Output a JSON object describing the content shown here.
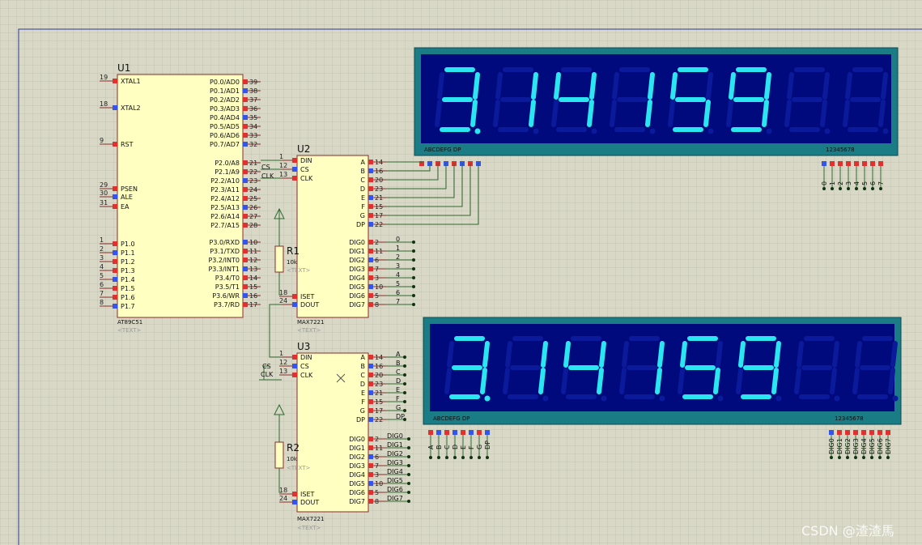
{
  "u1": {
    "ref": "U1",
    "part": "AT89C51",
    "text_placeholder": "<TEXT>",
    "left_pins": [
      {
        "num": "19",
        "label": "XTAL1"
      },
      {
        "num": "18",
        "label": "XTAL2"
      },
      {
        "num": "9",
        "label": "RST"
      },
      {
        "num": "29",
        "label": "PSEN"
      },
      {
        "num": "30",
        "label": "ALE"
      },
      {
        "num": "31",
        "label": "EA"
      },
      {
        "num": "1",
        "label": "P1.0"
      },
      {
        "num": "2",
        "label": "P1.1"
      },
      {
        "num": "3",
        "label": "P1.2"
      },
      {
        "num": "4",
        "label": "P1.3"
      },
      {
        "num": "5",
        "label": "P1.4"
      },
      {
        "num": "6",
        "label": "P1.5"
      },
      {
        "num": "7",
        "label": "P1.6"
      },
      {
        "num": "8",
        "label": "P1.7"
      }
    ],
    "right_pins": [
      {
        "num": "39",
        "label": "P0.0/AD0"
      },
      {
        "num": "38",
        "label": "P0.1/AD1"
      },
      {
        "num": "37",
        "label": "P0.2/AD2"
      },
      {
        "num": "36",
        "label": "P0.3/AD3"
      },
      {
        "num": "35",
        "label": "P0.4/AD4"
      },
      {
        "num": "34",
        "label": "P0.5/AD5"
      },
      {
        "num": "33",
        "label": "P0.6/AD6"
      },
      {
        "num": "32",
        "label": "P0.7/AD7"
      },
      {
        "num": "21",
        "label": "P2.0/A8"
      },
      {
        "num": "22",
        "label": "P2.1/A9"
      },
      {
        "num": "23",
        "label": "P2.2/A10"
      },
      {
        "num": "24",
        "label": "P2.3/A11"
      },
      {
        "num": "25",
        "label": "P2.4/A12"
      },
      {
        "num": "26",
        "label": "P2.5/A13"
      },
      {
        "num": "27",
        "label": "P2.6/A14"
      },
      {
        "num": "28",
        "label": "P2.7/A15"
      },
      {
        "num": "10",
        "label": "P3.0/RXD"
      },
      {
        "num": "11",
        "label": "P3.1/TXD"
      },
      {
        "num": "12",
        "label": "P3.2/INT0"
      },
      {
        "num": "13",
        "label": "P3.3/INT1"
      },
      {
        "num": "14",
        "label": "P3.4/T0"
      },
      {
        "num": "15",
        "label": "P3.5/T1"
      },
      {
        "num": "16",
        "label": "P3.6/WR"
      },
      {
        "num": "17",
        "label": "P3.7/RD"
      }
    ]
  },
  "u2": {
    "ref": "U2",
    "part": "MAX7221",
    "text_placeholder": "<TEXT>",
    "left_pins": [
      {
        "num": "1",
        "label": "DIN"
      },
      {
        "num": "12",
        "label": "CS"
      },
      {
        "num": "13",
        "label": "CLK"
      },
      {
        "num": "18",
        "label": "ISET"
      },
      {
        "num": "24",
        "label": "DOUT"
      }
    ],
    "right_pins": [
      {
        "num": "14",
        "label": "A"
      },
      {
        "num": "16",
        "label": "B"
      },
      {
        "num": "20",
        "label": "C"
      },
      {
        "num": "23",
        "label": "D"
      },
      {
        "num": "21",
        "label": "E"
      },
      {
        "num": "15",
        "label": "F"
      },
      {
        "num": "17",
        "label": "G"
      },
      {
        "num": "22",
        "label": "DP"
      },
      {
        "num": "2",
        "label": "DIG0"
      },
      {
        "num": "11",
        "label": "DIG1"
      },
      {
        "num": "6",
        "label": "DIG2"
      },
      {
        "num": "7",
        "label": "DIG3"
      },
      {
        "num": "3",
        "label": "DIG4"
      },
      {
        "num": "10",
        "label": "DIG5"
      },
      {
        "num": "5",
        "label": "DIG6"
      },
      {
        "num": "8",
        "label": "DIG7"
      }
    ],
    "digit_net_labels": [
      "0",
      "1",
      "2",
      "3",
      "4",
      "5",
      "6",
      "7"
    ]
  },
  "u3": {
    "ref": "U3",
    "part": "MAX7221",
    "text_placeholder": "<TEXT>",
    "left_pins": [
      {
        "num": "1",
        "label": "DIN"
      },
      {
        "num": "12",
        "label": "CS"
      },
      {
        "num": "13",
        "label": "CLK"
      },
      {
        "num": "18",
        "label": "ISET"
      },
      {
        "num": "24",
        "label": "DOUT"
      }
    ],
    "right_pins": [
      {
        "num": "14",
        "label": "A"
      },
      {
        "num": "16",
        "label": "B"
      },
      {
        "num": "20",
        "label": "C"
      },
      {
        "num": "23",
        "label": "D"
      },
      {
        "num": "21",
        "label": "E"
      },
      {
        "num": "15",
        "label": "F"
      },
      {
        "num": "17",
        "label": "G"
      },
      {
        "num": "22",
        "label": "DP"
      },
      {
        "num": "2",
        "label": "DIG0"
      },
      {
        "num": "11",
        "label": "DIG1"
      },
      {
        "num": "6",
        "label": "DIG2"
      },
      {
        "num": "7",
        "label": "DIG3"
      },
      {
        "num": "3",
        "label": "DIG4"
      },
      {
        "num": "10",
        "label": "DIG5"
      },
      {
        "num": "5",
        "label": "DIG6"
      },
      {
        "num": "8",
        "label": "DIG7"
      }
    ],
    "seg_net_labels": [
      "A",
      "B",
      "C",
      "D",
      "E",
      "F",
      "G",
      "DP"
    ],
    "digit_net_labels": [
      "DIG0",
      "DIG1",
      "DIG2",
      "DIG3",
      "DIG4",
      "DIG5",
      "DIG6",
      "DIG7"
    ]
  },
  "r1": {
    "ref": "R1",
    "value": "10k",
    "text_placeholder": "<TEXT>"
  },
  "r2": {
    "ref": "R2",
    "value": "10k",
    "text_placeholder": "<TEXT>"
  },
  "net_labels": {
    "cs": "CS",
    "clk": "CLK"
  },
  "display1": {
    "digits": [
      "3.",
      "1",
      "4",
      "1",
      "5",
      "9",
      "",
      ""
    ],
    "seg_header": "ABCDEFG  DP",
    "dig_header": "12345678",
    "seg_pin_labels": [],
    "dig_pin_labels": [
      "0",
      "1",
      "2",
      "3",
      "4",
      "5",
      "6",
      "7"
    ]
  },
  "display2": {
    "digits": [
      "3.",
      "1",
      "4",
      "1",
      "5",
      "9",
      "",
      ""
    ],
    "seg_header": "ABCDEFG  DP",
    "dig_header": "12345678",
    "seg_pin_labels": [
      "A",
      "B",
      "C",
      "D",
      "E",
      "F",
      "G",
      "DP"
    ],
    "dig_pin_labels": [
      "DIG0",
      "DIG1",
      "DIG2",
      "DIG3",
      "DIG4",
      "DIG5",
      "DIG6",
      "DIG7"
    ]
  },
  "watermark": "CSDN @渣渣馬",
  "colors": {
    "background": "#d9d8c7",
    "grid": "#c4c3b1",
    "chip_fill": "#ffffc2",
    "chip_stroke": "#8a2a2a",
    "wire": "#2d6a2d",
    "display_outer": "#1a7c84",
    "display_inner": "#000a7c",
    "segment_on": "#29e6f0",
    "segment_off": "#0a1a9a",
    "pin_red": "#e03030",
    "pin_blue": "#3355ee"
  }
}
